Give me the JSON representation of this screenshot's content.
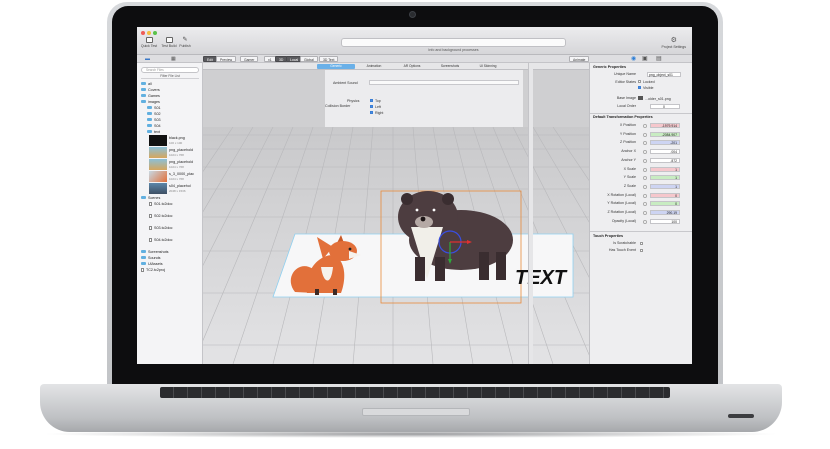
{
  "window": {
    "toolbar": {
      "quick_test": "Quick Test",
      "test_build": "Test Build",
      "publish": "Publish",
      "status_text": "Info and background processes",
      "project_settings": "Project Settings"
    },
    "topbar": {
      "segments": [
        "Edit",
        "Preview",
        "Gamer",
        "x1",
        "3D",
        "Local",
        "Global",
        "3D Text"
      ],
      "animate": "Animate"
    },
    "tabs": [
      "Generic",
      "Animation",
      "AR Options",
      "Screenshots",
      "UI Skinning"
    ],
    "inspector": {
      "ambient_label": "Ambient Sound",
      "physics_label": "Physics",
      "collision_label": "Collision Border",
      "options": [
        "Top",
        "Left",
        "Right"
      ]
    }
  },
  "file_list": {
    "search_placeholder": "Search Files",
    "label": "Filter File List",
    "items": [
      {
        "label": "all",
        "kind": "folder"
      },
      {
        "label": "Covers",
        "kind": "folder"
      },
      {
        "label": "Games",
        "kind": "folder"
      },
      {
        "label": "images",
        "kind": "folder"
      },
      {
        "label": "S01",
        "kind": "folder"
      },
      {
        "label": "S02",
        "kind": "folder"
      },
      {
        "label": "S03",
        "kind": "folder"
      },
      {
        "label": "S04",
        "kind": "folder"
      },
      {
        "label": "text",
        "kind": "folder"
      }
    ],
    "thumbs": [
      {
        "name": "black.png",
        "size": "100 x 100"
      },
      {
        "name": "png_placehold",
        "size": "1024 x 768"
      },
      {
        "name": "png_placehold",
        "size": "1024 x 768"
      },
      {
        "name": "s_3_0000_plac",
        "size": "1024 x 768"
      },
      {
        "name": "s04_placehol",
        "size": "2048 x 1536"
      }
    ],
    "scenes_folder": "Scenes",
    "scenes": [
      "S01.tc2doc",
      "S02.tc2doc",
      "S03.tc2doc",
      "S04.tc2doc"
    ],
    "tail": [
      {
        "label": "Screenshots",
        "kind": "folder"
      },
      {
        "label": "Sounds",
        "kind": "folder"
      },
      {
        "label": "UiAssets",
        "kind": "folder"
      },
      {
        "label": "TC2.tc2proj",
        "kind": "file"
      }
    ]
  },
  "canvas": {
    "overlay_text": "TEXT"
  },
  "properties": {
    "generic_title": "Generic Properties",
    "unique_name_label": "Unique Name",
    "unique_name": "png_object_s01",
    "editor_states_label": "Editor States",
    "locked": "Locked",
    "visible": "Visible",
    "base_image_label": "Base Image",
    "base_image": "...older_s01.png",
    "local_order_label": "Local Order",
    "local_order": "0",
    "transform_title": "Default Transformation Properties",
    "rows": [
      {
        "label": "X Position",
        "value": "-1979.914",
        "tone": "red"
      },
      {
        "label": "Y Position",
        "value": "-2084.907",
        "tone": "green"
      },
      {
        "label": "Z Position",
        "value": "-201",
        "tone": "blue"
      },
      {
        "label": "Anchor X",
        "value": ".004",
        "tone": ""
      },
      {
        "label": "Anchor Y",
        "value": ".872",
        "tone": ""
      },
      {
        "label": "X Scale",
        "value": "1",
        "tone": "red"
      },
      {
        "label": "Y Scale",
        "value": "1",
        "tone": "green"
      },
      {
        "label": "Z Scale",
        "value": "1",
        "tone": "blue"
      },
      {
        "label": "X Rotation (Local)",
        "value": "0",
        "tone": "red"
      },
      {
        "label": "Y Rotation (Local)",
        "value": "0",
        "tone": "green"
      },
      {
        "label": "Z Rotation (Local)",
        "value": "290.19",
        "tone": "blue"
      },
      {
        "label": "Opacity (Local)",
        "value": "100",
        "tone": ""
      }
    ],
    "touch_title": "Touch Properties",
    "is_scratchable": "Is Scratchable",
    "has_touch_event": "Has Touch Event"
  }
}
